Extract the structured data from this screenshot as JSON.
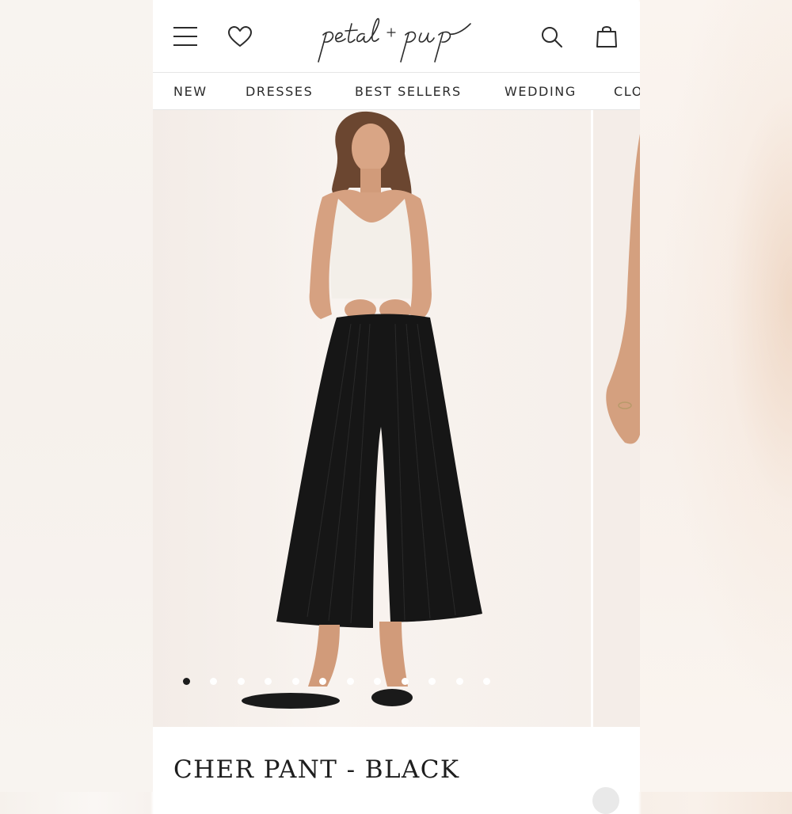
{
  "brand": {
    "logo_text": "petal + pup",
    "colors": {
      "text": "#2b2b2b",
      "background": "#ffffff",
      "border": "#e6e6e6",
      "dot_active": "#1c1c1c",
      "dot_inactive": "#ffffff"
    }
  },
  "header": {
    "icons": [
      "menu-icon",
      "heart-icon",
      "search-icon",
      "shopping-bag-icon"
    ]
  },
  "nav": {
    "items": [
      {
        "label": "NEW"
      },
      {
        "label": "DRESSES"
      },
      {
        "label": "BEST SELLERS"
      },
      {
        "label": "WEDDING"
      },
      {
        "label": "CLO"
      }
    ]
  },
  "gallery": {
    "image_count": 12,
    "active_index": 0
  },
  "product": {
    "title": "CHER PANT - BLACK"
  }
}
